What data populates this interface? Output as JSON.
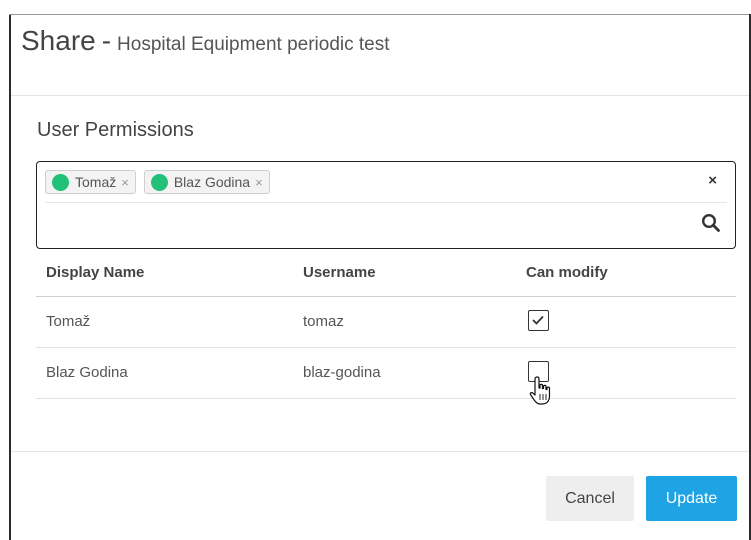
{
  "dialog": {
    "title": "Share",
    "separator": "-",
    "subtitle": "Hospital Equipment periodic test"
  },
  "permissions": {
    "section_title": "User Permissions",
    "tags": [
      {
        "label": "Tomaž",
        "remove": "×",
        "color": "#23c07a"
      },
      {
        "label": "Blaz Godina",
        "remove": "×",
        "color": "#23c07a"
      }
    ],
    "clear_all": "×",
    "search": {
      "value": "",
      "placeholder": "",
      "icon": "search-icon"
    }
  },
  "table": {
    "columns": [
      "Display Name",
      "Username",
      "Can modify"
    ],
    "rows": [
      {
        "display_name": "Tomaž",
        "username": "tomaz",
        "can_modify": true
      },
      {
        "display_name": "Blaz Godina",
        "username": "blaz-godina",
        "can_modify": false
      }
    ]
  },
  "footer": {
    "cancel_label": "Cancel",
    "update_label": "Update"
  },
  "colors": {
    "accent": "#1ea3e4",
    "tag_dot": "#23c07a"
  }
}
